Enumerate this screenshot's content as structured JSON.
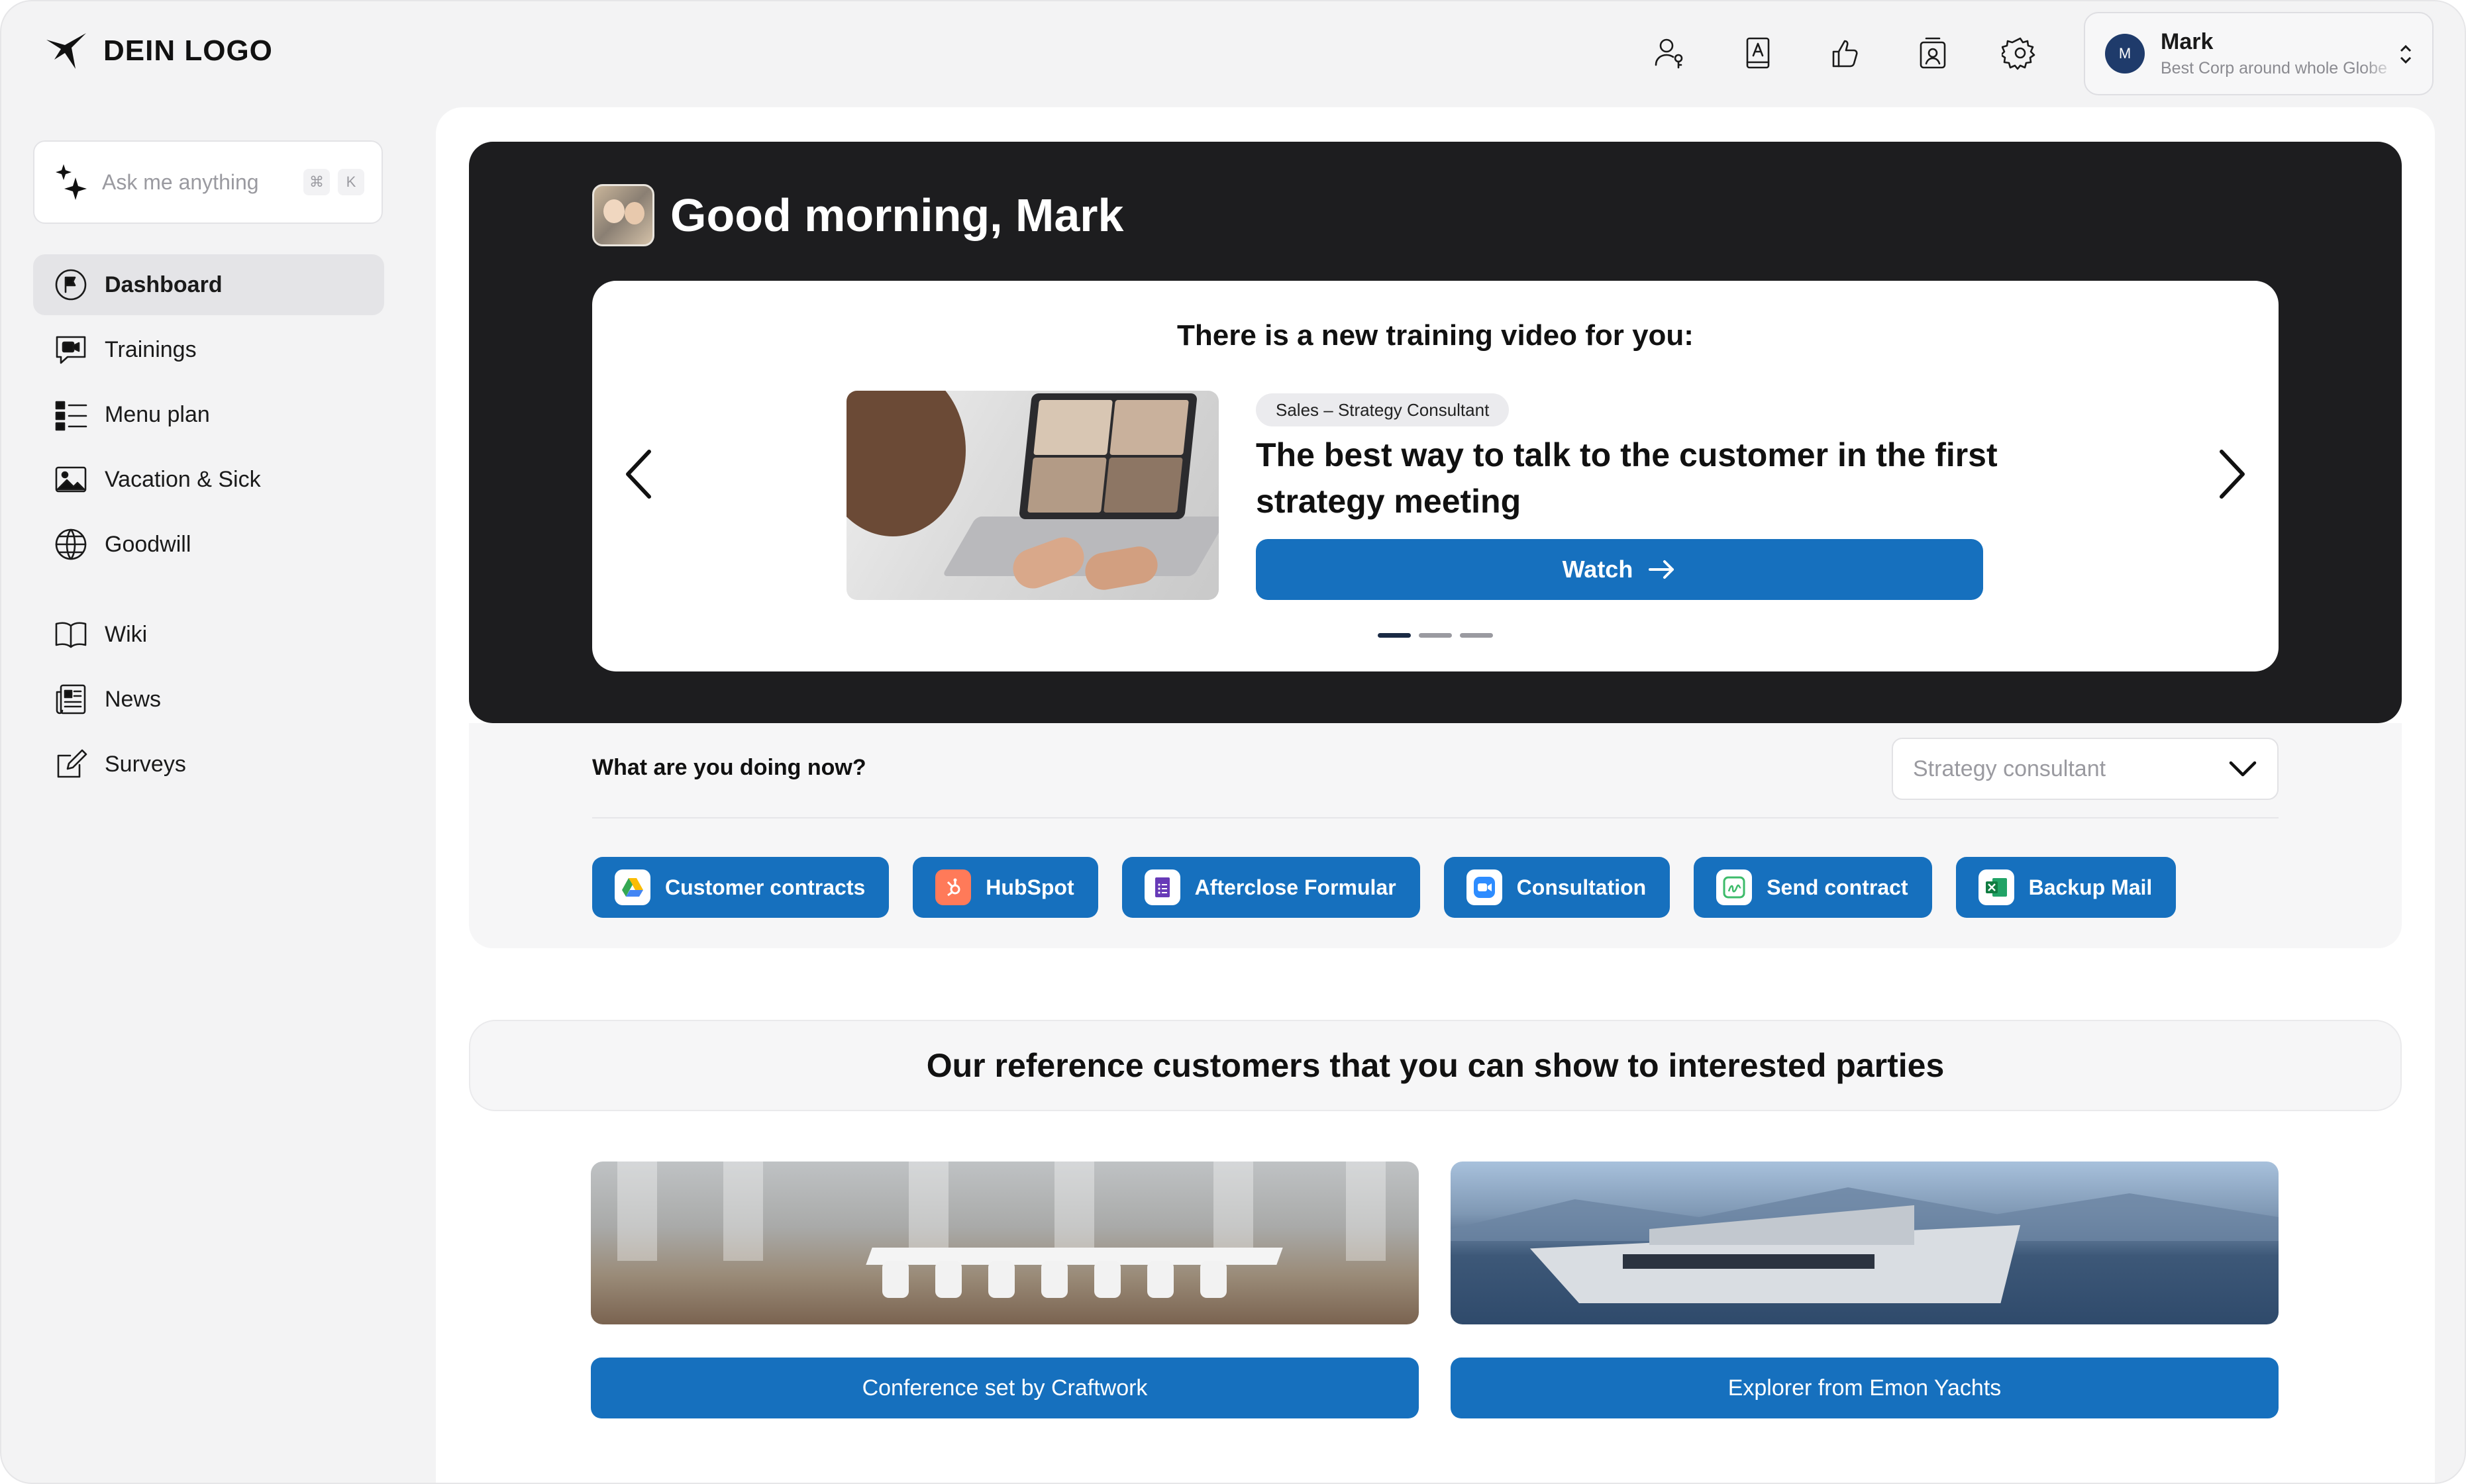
{
  "header": {
    "logo_text": "DEIN LOGO",
    "icons": [
      "user-key-icon",
      "contacts-book-icon",
      "thumbs-up-icon",
      "id-badge-icon",
      "gear-icon"
    ],
    "user": {
      "initial": "M",
      "name": "Mark",
      "org": "Best Corp around whole Globe"
    }
  },
  "sidebar": {
    "ask_placeholder": "Ask me anything",
    "shortcut": [
      "⌘",
      "K"
    ],
    "items": [
      {
        "label": "Dashboard",
        "icon": "flag-circle-icon",
        "active": true
      },
      {
        "label": "Trainings",
        "icon": "video-chat-icon"
      },
      {
        "label": "Menu plan",
        "icon": "list-icon"
      },
      {
        "label": "Vacation & Sick",
        "icon": "image-icon"
      },
      {
        "label": "Goodwill",
        "icon": "globe-icon"
      },
      {
        "label": "Wiki",
        "icon": "book-icon"
      },
      {
        "label": "News",
        "icon": "newspaper-icon"
      },
      {
        "label": "Surveys",
        "icon": "edit-square-icon"
      }
    ]
  },
  "hero": {
    "greeting": "Good morning, Mark",
    "card_title": "There is a new training video for you:",
    "tag": "Sales – Strategy Consultant",
    "video_title": "The best way to talk to the customer in the first strategy meeting",
    "watch_label": "Watch",
    "slides": 3,
    "active_slide": 1
  },
  "doing": {
    "label": "What are you doing now?",
    "selected": "Strategy consultant",
    "quick_links": [
      {
        "label": "Customer contracts",
        "icon": "google-drive-icon"
      },
      {
        "label": "HubSpot",
        "icon": "hubspot-icon"
      },
      {
        "label": "Afterclose Formular",
        "icon": "forms-icon"
      },
      {
        "label": "Consultation",
        "icon": "video-call-icon"
      },
      {
        "label": "Send contract",
        "icon": "sign-icon"
      },
      {
        "label": "Backup Mail",
        "icon": "excel-icon"
      }
    ]
  },
  "references": {
    "heading": "Our reference customers that you can show to interested parties",
    "items": [
      {
        "label": "Conference set by Craftwork"
      },
      {
        "label": "Explorer from Emon Yachts"
      }
    ]
  },
  "colors": {
    "primary": "#1670be",
    "hero_bg": "#1d1d1f",
    "background": "#f3f3f4"
  }
}
